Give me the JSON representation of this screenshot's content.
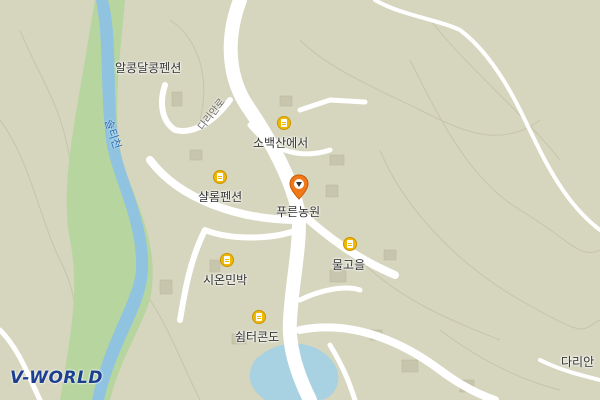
{
  "map": {
    "provider_logo": "V-WORLD",
    "colors": {
      "land": "#d6d5be",
      "green_area": "#a8cf94",
      "river": "#8fc3e0",
      "road": "#ffffff",
      "poi": "#f0b800",
      "marker": "#f07818"
    },
    "labels": {
      "pension1": "알콩달콩펜션",
      "sobaeksan": "소백산에서",
      "saron": "샬롬펜션",
      "pureun": "푸른농원",
      "mulgoeul": "물고을",
      "sion": "시온민박",
      "shelter": "쉼터콘도",
      "darian": "다리안",
      "road_name": "다리안로",
      "river_name": "솔티천"
    },
    "icons": {
      "poi": "lodging-icon",
      "marker": "location-pin-icon"
    }
  }
}
